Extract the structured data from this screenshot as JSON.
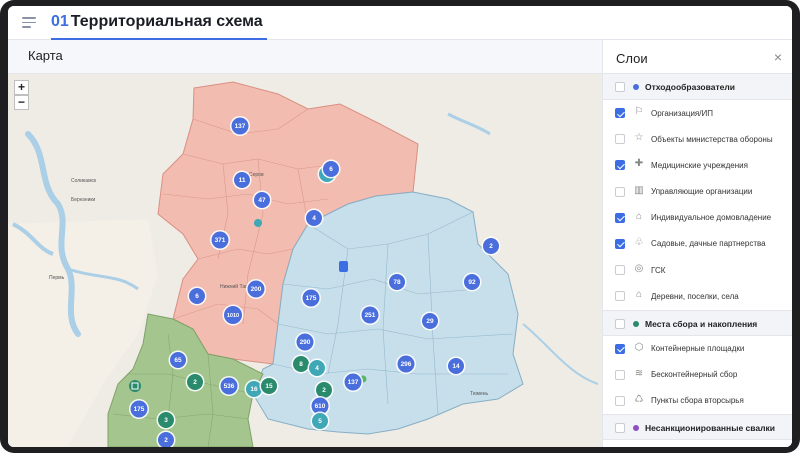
{
  "header": {
    "number": "01",
    "title": "Территориальная схема"
  },
  "map": {
    "title": "Карта",
    "zoom_in": "+",
    "zoom_out": "−",
    "labels": [
      {
        "text": "Соликамск"
      },
      {
        "text": "Березники"
      },
      {
        "text": "Пермь"
      },
      {
        "text": "Серов"
      },
      {
        "text": "Нижний Тагил"
      },
      {
        "text": "Тюмень"
      }
    ],
    "clusters": [
      {
        "value": "137",
        "color": "#4a6fdc"
      },
      {
        "value": "11",
        "color": "#4a6fdc"
      },
      {
        "value": "47",
        "color": "#4a6fdc"
      },
      {
        "value": "2",
        "color": "#3fa7b5"
      },
      {
        "value": "4",
        "color": "#4a6fdc"
      },
      {
        "value": "371",
        "color": "#4a6fdc"
      },
      {
        "value": "6",
        "color": "#4a6fdc"
      },
      {
        "value": "2",
        "color": "#4a6fdc"
      },
      {
        "value": "200",
        "color": "#4a6fdc"
      },
      {
        "value": "6",
        "color": "#4a6fdc"
      },
      {
        "value": "1010",
        "color": "#4a6fdc"
      },
      {
        "value": "175",
        "color": "#4a6fdc"
      },
      {
        "value": "78",
        "color": "#4a6fdc"
      },
      {
        "value": "92",
        "color": "#4a6fdc"
      },
      {
        "value": "251",
        "color": "#4a6fdc"
      },
      {
        "value": "29",
        "color": "#4a6fdc"
      },
      {
        "value": "290",
        "color": "#4a6fdc"
      },
      {
        "value": "65",
        "color": "#4a6fdc"
      },
      {
        "value": "8",
        "color": "#2a8a6c"
      },
      {
        "value": "4",
        "color": "#3fa7b5"
      },
      {
        "value": "296",
        "color": "#4a6fdc"
      },
      {
        "value": "14",
        "color": "#4a6fdc"
      },
      {
        "value": "2",
        "color": "#2a8a6c"
      },
      {
        "value": "536",
        "color": "#4a6fdc"
      },
      {
        "value": "16",
        "color": "#3fa7b5"
      },
      {
        "value": "15",
        "color": "#2a8a6c"
      },
      {
        "value": "2",
        "color": "#2a8a6c"
      },
      {
        "value": "137",
        "color": "#4a6fdc"
      },
      {
        "value": "175",
        "color": "#4a6fdc"
      },
      {
        "value": "3",
        "color": "#2a8a6c"
      },
      {
        "value": "610",
        "color": "#4a6fdc"
      },
      {
        "value": "5",
        "color": "#3fa7b5"
      },
      {
        "value": "2",
        "color": "#4a6fdc"
      }
    ]
  },
  "layers": {
    "title": "Слои",
    "close": "×",
    "groups": [
      {
        "label": "Отходообразователи",
        "dot_color": "#4a6fdc",
        "checked": false,
        "items": [
          {
            "label": "Организация/ИП",
            "icon": "flag-icon",
            "glyph": "⚐",
            "checked": true
          },
          {
            "label": "Объекты министерства обороны",
            "icon": "star-icon",
            "glyph": "☆",
            "checked": false
          },
          {
            "label": "Медицинские учреждения",
            "icon": "medical-cross-icon",
            "glyph": "✚",
            "checked": true
          },
          {
            "label": "Управляющие организации",
            "icon": "building-icon",
            "glyph": "▥",
            "checked": false
          },
          {
            "label": "Индивидуальное домовладение",
            "icon": "house-icon",
            "glyph": "⌂",
            "checked": true
          },
          {
            "label": "Садовые, дачные партнерства",
            "icon": "tree-icon",
            "glyph": "♧",
            "checked": true
          },
          {
            "label": "ГСК",
            "icon": "garage-icon",
            "glyph": "◎",
            "checked": false
          },
          {
            "label": "Деревни, поселки, села",
            "icon": "village-icon",
            "glyph": "⌂",
            "checked": false
          }
        ]
      },
      {
        "label": "Места сбора и накопления",
        "dot_color": "#2a8a6c",
        "checked": false,
        "items": [
          {
            "label": "Контейнерные площадки",
            "icon": "container-icon",
            "glyph": "⬡",
            "checked": true
          },
          {
            "label": "Бесконтейнерный сбор",
            "icon": "layers-icon",
            "glyph": "≋",
            "checked": false
          },
          {
            "label": "Пункты сбора вторсырья",
            "icon": "recycle-icon",
            "glyph": "♺",
            "checked": false
          }
        ]
      },
      {
        "label": "Несанкционированные свалки",
        "dot_color": "#8b4fc2",
        "checked": false,
        "items": []
      }
    ]
  }
}
